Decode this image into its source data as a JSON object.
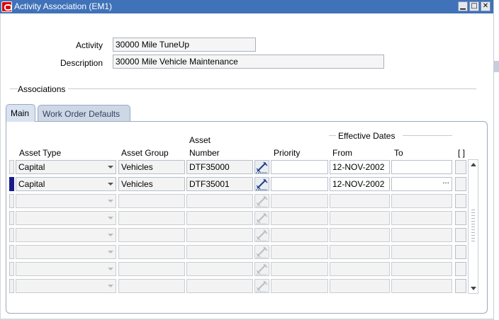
{
  "window": {
    "title": "Activity Association (EM1)",
    "buttons": {
      "minimize": "▁",
      "maximize": "□",
      "close": "✕"
    }
  },
  "header": {
    "activity_label": "Activity",
    "activity_value": "30000 Mile TuneUp",
    "description_label": "Description",
    "description_value": "30000 Mile Vehicle Maintenance"
  },
  "associations": {
    "section_title": "Associations",
    "tabs": [
      {
        "label": "Main",
        "active": true
      },
      {
        "label": "Work Order Defaults",
        "active": false
      }
    ],
    "group_header": "Effective Dates",
    "columns": {
      "asset_type": "Asset Type",
      "asset_group": "Asset Group",
      "asset_number_line1": "Asset",
      "asset_number_line2": "Number",
      "priority": "Priority",
      "from": "From",
      "to": "To",
      "flex": "[ ]"
    },
    "rows": [
      {
        "asset_type": "Capital",
        "asset_group": "Vehicles",
        "asset_number": "DTF35000",
        "priority": "",
        "from": "12-NOV-2002",
        "to": ""
      },
      {
        "asset_type": "Capital",
        "asset_group": "Vehicles",
        "asset_number": "DTF35001",
        "priority": "",
        "from": "12-NOV-2002",
        "to": ""
      },
      {
        "asset_type": "",
        "asset_group": "",
        "asset_number": "",
        "priority": "",
        "from": "",
        "to": ""
      },
      {
        "asset_type": "",
        "asset_group": "",
        "asset_number": "",
        "priority": "",
        "from": "",
        "to": ""
      },
      {
        "asset_type": "",
        "asset_group": "",
        "asset_number": "",
        "priority": "",
        "from": "",
        "to": ""
      },
      {
        "asset_type": "",
        "asset_group": "",
        "asset_number": "",
        "priority": "",
        "from": "",
        "to": ""
      },
      {
        "asset_type": "",
        "asset_group": "",
        "asset_number": "",
        "priority": "",
        "from": "",
        "to": ""
      },
      {
        "asset_type": "",
        "asset_group": "",
        "asset_number": "",
        "priority": "",
        "from": "",
        "to": ""
      }
    ],
    "lov_button": "..."
  },
  "colors": {
    "title_bar": "#3f72b8",
    "current_record_indicator": "#1a1a8c",
    "tab_active": "#d8e2f1"
  }
}
